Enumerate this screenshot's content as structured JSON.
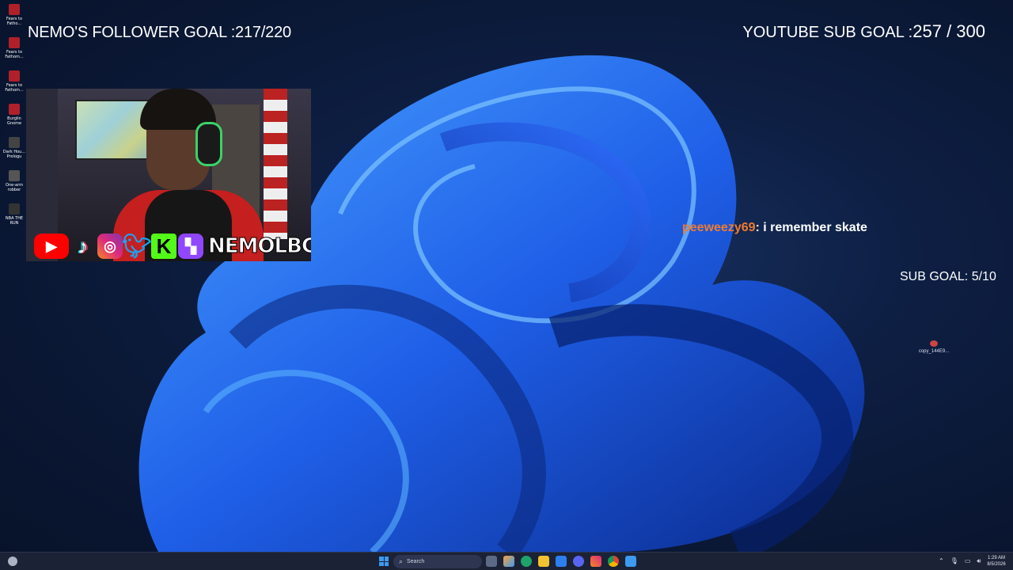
{
  "overlay": {
    "follower_goal": "NEMO'S FOLLOWER GOAL :217/220",
    "youtube_goal_label": "YOUTUBE SUB GOAL :",
    "youtube_goal_value": "257 / 300",
    "sub_goal": "SUB GOAL: 5/10",
    "social_handle": "NEMOLBC",
    "chat": {
      "user": "peeweezy69",
      "message": ": i remember skate"
    }
  },
  "desktop_icons": [
    {
      "label": "Fears to Fatho...",
      "icon": "game-icon"
    },
    {
      "label": "Fears to Fathom...",
      "icon": "game-icon"
    },
    {
      "label": "Fears to Fathom...",
      "icon": "game-icon"
    },
    {
      "label": "Burglin Gnome",
      "icon": "game-icon"
    },
    {
      "label": "Dark Hou... Prologu",
      "icon": "game-icon"
    },
    {
      "label": "One-arm robber",
      "icon": "game-icon"
    },
    {
      "label": "NBA THE RUN",
      "icon": "game-icon"
    }
  ],
  "desktop_file": {
    "label": "copy_144E9..."
  },
  "taskbar": {
    "search_placeholder": "Search",
    "time": "1:29 AM",
    "date": "8/5/2026",
    "apps": [
      "edge-icon",
      "file-explorer-icon",
      "chrome-icon",
      "discord-icon",
      "store-icon",
      "instagram-icon",
      "obs-icon",
      "app-icon"
    ]
  },
  "colors": {
    "chat_user": "#f07b2e",
    "accent": "#3d9af0"
  }
}
